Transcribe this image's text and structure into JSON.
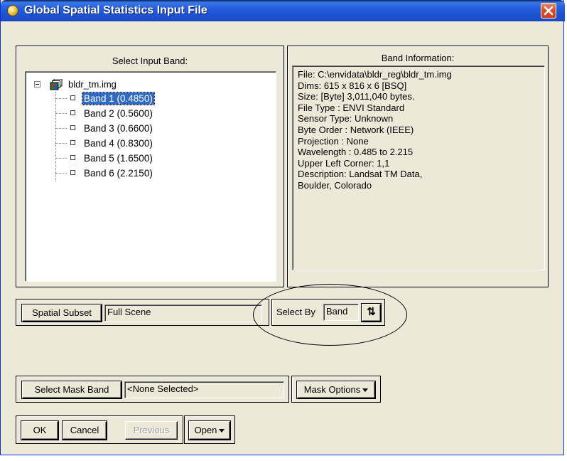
{
  "window": {
    "title": "Global Spatial Statistics Input File",
    "close_symbol": "✕"
  },
  "select_input_band": {
    "label": "Select Input Band:",
    "root": {
      "label": "bldr_tm.img",
      "icon": "multi-band-image-icon",
      "expanded": true
    },
    "bands": [
      {
        "label": "Band 1 (0.4850)",
        "selected": true
      },
      {
        "label": "Band 2 (0.5600)",
        "selected": false
      },
      {
        "label": "Band 3 (0.6600)",
        "selected": false
      },
      {
        "label": "Band 4 (0.8300)",
        "selected": false
      },
      {
        "label": "Band 5 (1.6500)",
        "selected": false
      },
      {
        "label": "Band 6 (2.2150)",
        "selected": false
      }
    ]
  },
  "band_information": {
    "label": "Band Information:",
    "lines": [
      "File: C:\\envidata\\bldr_reg\\bldr_tm.img",
      "Dims: 615 x 816 x 6 [BSQ]",
      "Size: [Byte] 3,011,040 bytes.",
      "File Type  : ENVI Standard",
      "Sensor Type: Unknown",
      "Byte Order : Network (IEEE)",
      "Projection : None",
      "Wavelength : 0.485 to 2.215",
      "Upper Left Corner: 1,1",
      "Description: Landsat TM Data,",
      "Boulder, Colorado"
    ]
  },
  "spatial_subset": {
    "button_label": "Spatial Subset",
    "value": "Full Scene"
  },
  "select_by": {
    "label": "Select By",
    "value": "Band",
    "toggle_icon": "sort-toggle-icon",
    "toggle_symbol": "⇅"
  },
  "mask": {
    "button_label": "Select Mask Band",
    "value": "<None Selected>",
    "options_label": "Mask Options"
  },
  "footer": {
    "ok_label": "OK",
    "cancel_label": "Cancel",
    "previous_label": "Previous",
    "previous_enabled": false,
    "open_label": "Open"
  },
  "colors": {
    "dialog_background": "#ece9d8",
    "title_bar": "#1e55d6",
    "selection": "#316ac5",
    "close_button": "#d6502c"
  }
}
